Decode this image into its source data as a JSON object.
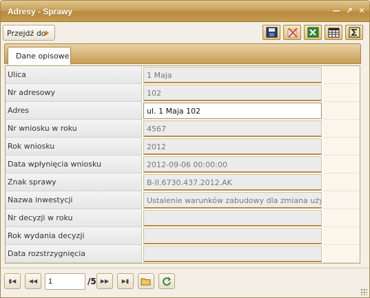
{
  "window": {
    "title": "Adresy - Sprawy",
    "controls": [
      "minimize-icon",
      "restore-icon",
      "close-icon"
    ]
  },
  "toolbar": {
    "goto_label": "Przejdź do",
    "buttons": [
      "save-icon",
      "cancel-edit-icon",
      "excel-export-icon",
      "table-view-icon",
      "sum-icon"
    ]
  },
  "tabs": [
    {
      "label": "Dane opisowe",
      "active": true
    }
  ],
  "fields": [
    {
      "label": "Ulica",
      "value": "1 Maja"
    },
    {
      "label": "Nr adresowy",
      "value": "102"
    },
    {
      "label": "Adres",
      "value": "ul. 1 Maja 102"
    },
    {
      "label": "Nr wniosku w roku",
      "value": "4567"
    },
    {
      "label": "Rok wniosku",
      "value": "2012"
    },
    {
      "label": "Data wpłynięcia wniosku",
      "value": "2012-09-06 00:00:00"
    },
    {
      "label": "Znak sprawy",
      "value": "B-II.6730.437.2012.AK"
    },
    {
      "label": "Nazwa inwestycji",
      "value": "Ustalenie warunków zabudowy dla zmiana użytkowa"
    },
    {
      "label": "Nr decyzji w roku",
      "value": ""
    },
    {
      "label": "Rok wydania decyzji",
      "value": ""
    },
    {
      "label": "Data rozstrzygnięcia",
      "value": ""
    }
  ],
  "pager": {
    "current": "1",
    "total": "/5"
  },
  "colors": {
    "accent": "#c9a15a",
    "border": "#a8874c"
  }
}
